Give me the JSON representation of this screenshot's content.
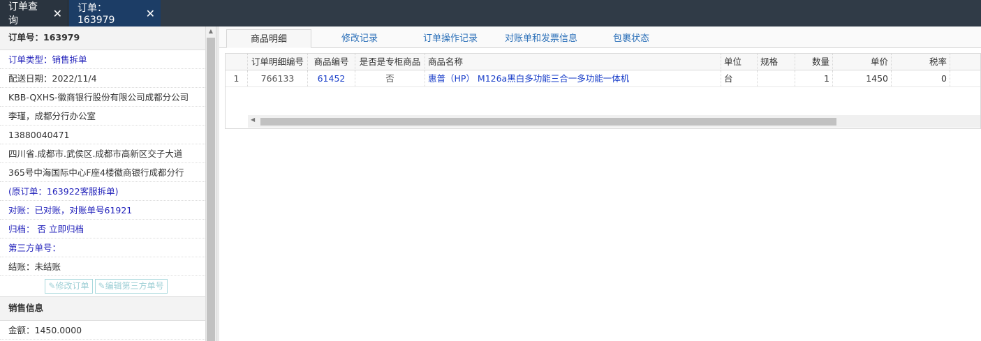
{
  "top_tabs": [
    {
      "label": "订单查询"
    },
    {
      "label": "订单：163979"
    }
  ],
  "left": {
    "order_no": "订单号：163979",
    "rows": [
      {
        "text": "订单类型：销售拆单",
        "blue": true
      },
      {
        "text": "配送日期：2022/11/4",
        "blue": false
      },
      {
        "text": "KBB-QXHS-徽商银行股份有限公司成都分公司",
        "blue": false
      },
      {
        "text": "李瑾，成都分行办公室",
        "blue": false
      },
      {
        "text": "13880040471",
        "blue": false
      },
      {
        "text": "四川省.成都市.武侯区.成都市高新区交子大道",
        "blue": false
      },
      {
        "text": "365号中海国际中心F座4楼徽商银行成都分行",
        "blue": false
      },
      {
        "text": "(原订单：163922客服拆单)",
        "blue": true
      },
      {
        "text": "对账：已对账，对账单号61921",
        "blue": true
      },
      {
        "text": "归档： 否 立即归档",
        "blue": true
      },
      {
        "text": "第三方单号：",
        "blue": true
      },
      {
        "text": "结账：未结账",
        "blue": false
      }
    ],
    "buttons": {
      "edit_order": "修改订单",
      "edit_third": "编辑第三方单号"
    },
    "sales_header": "销售信息",
    "amount": "金额：1450.0000"
  },
  "sub_tabs": [
    {
      "label": "商品明细",
      "active": true
    },
    {
      "label": "修改记录",
      "active": false
    },
    {
      "label": "订单操作记录",
      "active": false
    },
    {
      "label": "对账单和发票信息",
      "active": false
    },
    {
      "label": "包裹状态",
      "active": false
    }
  ],
  "grid": {
    "columns": [
      "",
      "订单明细编号",
      "商品编号",
      "是否是专柜商品",
      "商品名称",
      "单位",
      "规格",
      "数量",
      "单价",
      "税率"
    ],
    "rows": [
      [
        "1",
        "766133",
        "61452",
        "否",
        "惠普（HP） M126a黑白多功能三合一多功能一体机",
        "台",
        "",
        "1",
        "1450",
        "0"
      ]
    ]
  }
}
